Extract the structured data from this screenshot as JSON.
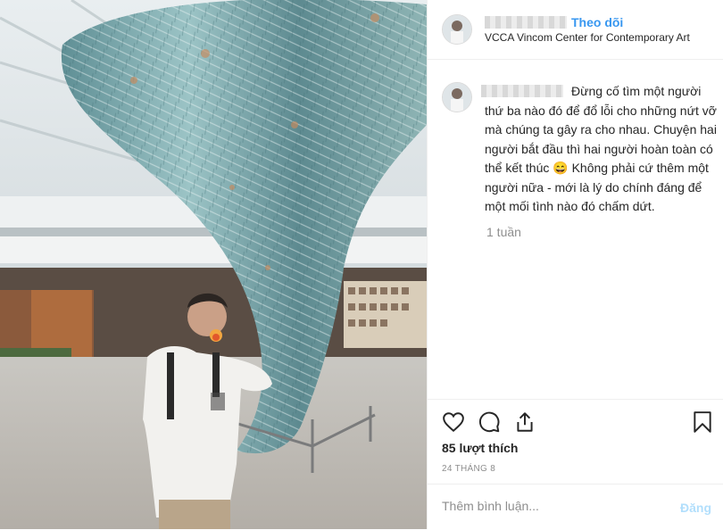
{
  "header": {
    "follow_label": "Theo dõi",
    "location": "VCCA Vincom Center for Contemporary Art"
  },
  "caption": {
    "text": "Đừng cố tìm một người thứ ba nào đó để đổ lỗi cho những nứt vỡ mà chúng ta gây ra cho nhau. Chuyện hai người bắt đầu thì hai người hoàn toàn có thể kết thúc 😄 Không phải cứ thêm một người nữa - mới là lý do chính đáng để một mối tình nào đó chấm dứt.",
    "time_ago": "1 tuần"
  },
  "actions": {
    "icons": [
      "heart-icon",
      "comment-icon",
      "share-icon",
      "bookmark-icon"
    ],
    "likes": "85 lượt thích",
    "date": "24 THÁNG 8"
  },
  "comment": {
    "placeholder": "Thêm bình luận...",
    "post_label": "Đăng"
  },
  "colors": {
    "accent": "#3897f0",
    "post_disabled": "#b2dffc",
    "secondary_text": "#8e8e8e"
  }
}
